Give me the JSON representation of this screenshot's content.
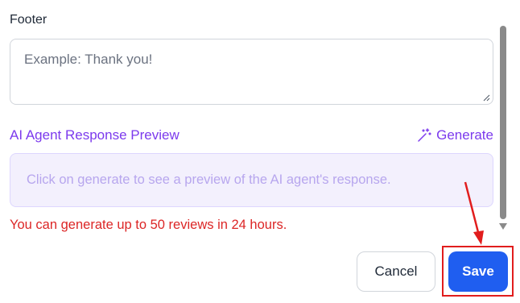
{
  "footer": {
    "label": "Footer",
    "placeholder": "Example: Thank you!"
  },
  "preview": {
    "title": "AI Agent Response Preview",
    "generate_label": "Generate",
    "placeholder_text": "Click on generate to see a preview of the AI agent's response."
  },
  "limit_notice": "You can generate up to 50 reviews in 24 hours.",
  "actions": {
    "cancel_label": "Cancel",
    "save_label": "Save"
  },
  "colors": {
    "accent_purple": "#7c3aed",
    "primary_blue": "#1f5ef0",
    "error_red": "#dc2626",
    "highlight_red": "#e11d1d"
  },
  "icons": {
    "generate": "magic-wand-icon"
  }
}
